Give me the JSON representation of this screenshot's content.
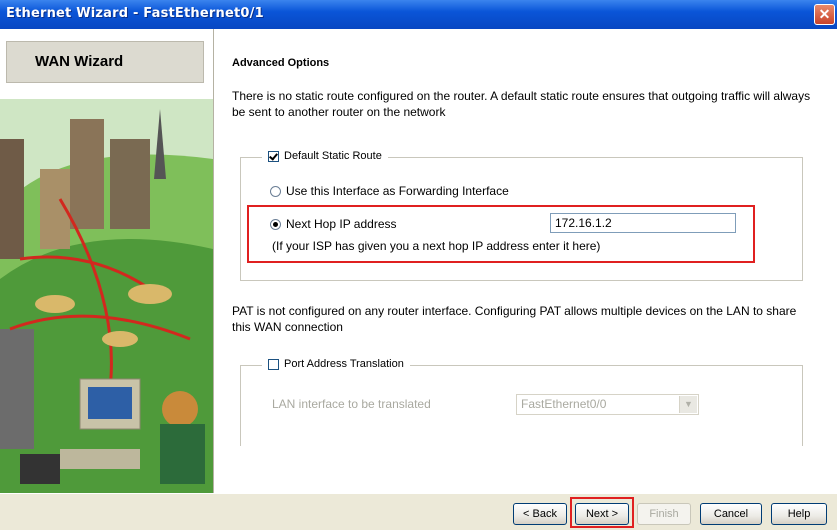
{
  "window": {
    "title": "Ethernet Wizard - FastEthernet0/1"
  },
  "sidebar": {
    "title": "WAN Wizard"
  },
  "main": {
    "heading": "Advanced Options",
    "description": "There is no static route configured on the router. A default static route ensures that outgoing traffic will always be sent to another router on the network",
    "static_route": {
      "checkbox_label": "Default Static Route",
      "checked": true,
      "option_interface_label": "Use this Interface as Forwarding Interface",
      "option_nexthop_label": "Next Hop IP address",
      "selected": "nexthop",
      "nexthop_value": "172.16.1.2",
      "hint": "(If your ISP has given you a next hop IP address enter it here)"
    },
    "pat_description": "PAT is not configured on any router interface. Configuring PAT allows multiple devices on the LAN to share this WAN connection",
    "pat": {
      "checkbox_label": "Port Address Translation",
      "checked": false,
      "lan_label": "LAN interface to be translated",
      "lan_value": "FastEthernet0/0"
    }
  },
  "buttons": {
    "back": "< Back",
    "next": "Next >",
    "finish": "Finish",
    "cancel": "Cancel",
    "help": "Help"
  },
  "colors": {
    "highlight": "#e02020",
    "titlebar": "#0a55d8"
  }
}
